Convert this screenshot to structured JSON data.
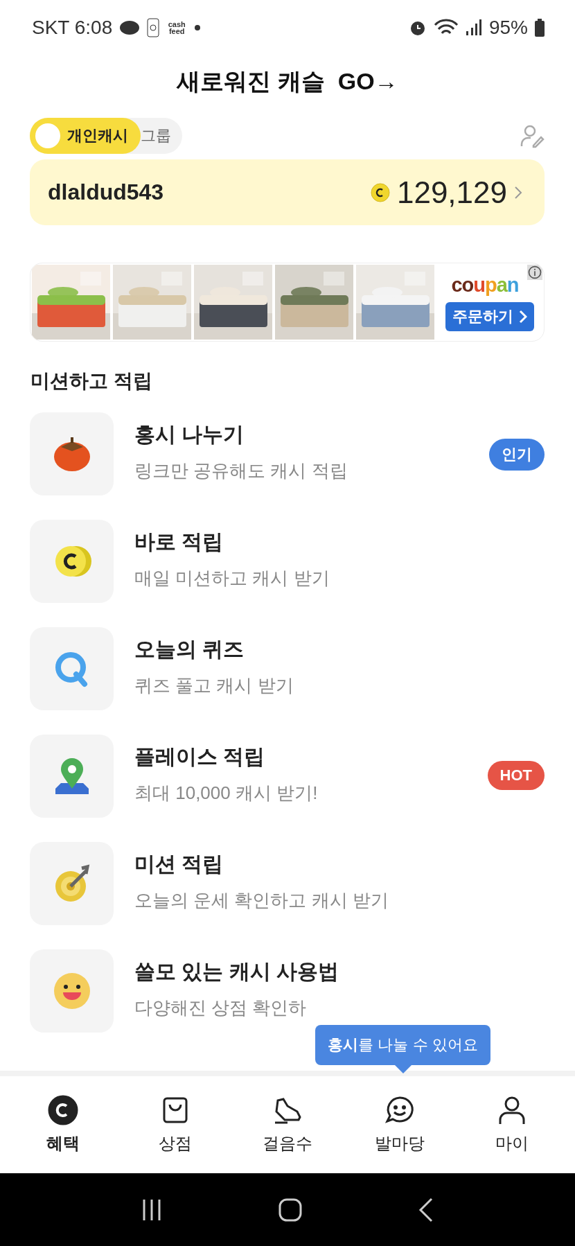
{
  "status_bar": {
    "carrier_time": "SKT 6:08",
    "notification_text": "cash feed",
    "battery": "95%"
  },
  "header": {
    "title": "새로워진 캐슬  GO→"
  },
  "cash_toggle": {
    "options": [
      {
        "label": "개인캐시",
        "selected": true
      },
      {
        "label": "그룹",
        "selected": false
      }
    ]
  },
  "account_card": {
    "username": "dlaldud543",
    "balance": "129,129"
  },
  "ad_banner": {
    "logo": "coupan",
    "order_button": "주문하기"
  },
  "section_title": "미션하고 적립",
  "missions": [
    {
      "kind": "persimmon",
      "title": "홍시 나누기",
      "subtitle": "링크만 공유해도 캐시 적립",
      "badge": "인기",
      "color": "#3f7fe0"
    },
    {
      "kind": "coin",
      "title": "바로 적립",
      "subtitle": "매일 미션하고 캐시 받기"
    },
    {
      "kind": "quiz",
      "title": "오늘의 퀴즈",
      "subtitle": "퀴즈 풀고 캐시 받기"
    },
    {
      "kind": "place",
      "title": "플레이스 적립",
      "subtitle": "최대 10,000 캐시 받기!",
      "badge": "HOT",
      "color": "#e65446"
    },
    {
      "kind": "target",
      "title": "미션 적립",
      "subtitle": "오늘의 운세 확인하고 캐시 받기"
    },
    {
      "kind": "smile",
      "title": "쓸모 있는 캐시 사용법",
      "subtitle": "다양해진 상점 확인하"
    }
  ],
  "tooltip": "**홍시**를 나눌 수 있어요",
  "bottom_nav": [
    {
      "kind": "coin",
      "label": "혜택",
      "selected": true
    },
    {
      "kind": "bag",
      "label": "상점",
      "selected": false
    },
    {
      "kind": "shoe",
      "label": "걸음수",
      "selected": false
    },
    {
      "kind": "chat",
      "label": "발마당",
      "selected": false
    },
    {
      "kind": "person",
      "label": "마이",
      "selected": false
    }
  ]
}
